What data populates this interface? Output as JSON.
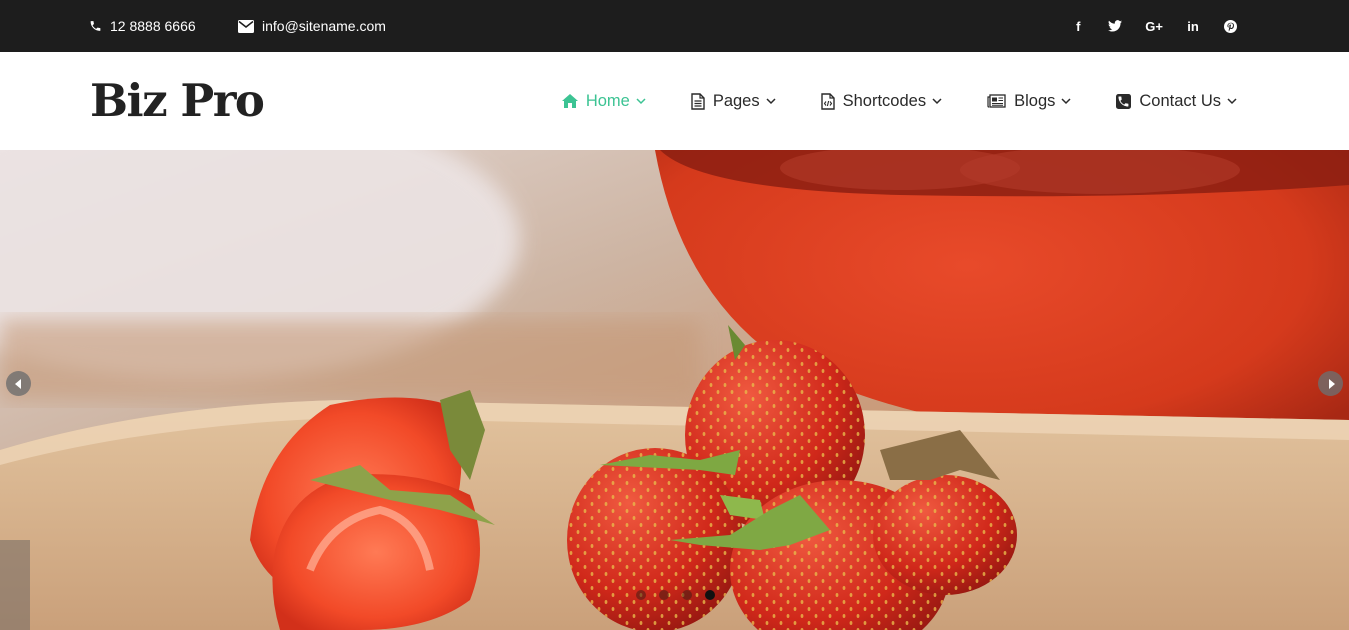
{
  "topbar": {
    "phone": "12 8888 6666",
    "email": "info@sitename.com",
    "social": [
      {
        "name": "facebook-icon",
        "glyph": "f"
      },
      {
        "name": "twitter-icon",
        "glyph": ""
      },
      {
        "name": "google-plus-icon",
        "glyph": "G+"
      },
      {
        "name": "linkedin-icon",
        "glyph": "in"
      },
      {
        "name": "pinterest-icon",
        "glyph": ""
      }
    ]
  },
  "header": {
    "logo": "Biz Pro",
    "nav": [
      {
        "label": "Home",
        "icon": "home-icon",
        "active": true
      },
      {
        "label": "Pages",
        "icon": "page-icon",
        "active": false
      },
      {
        "label": "Shortcodes",
        "icon": "code-file-icon",
        "active": false
      },
      {
        "label": "Blogs",
        "icon": "newspaper-icon",
        "active": false
      },
      {
        "label": "Contact Us",
        "icon": "phone-square-icon",
        "active": false
      }
    ]
  },
  "slider": {
    "image": "strawberries-on-cutting-board",
    "dots": 4,
    "active_dot": 4
  },
  "colors": {
    "accent": "#3cc393",
    "topbar_bg": "#1d1d1d",
    "text_dark": "#222222"
  }
}
